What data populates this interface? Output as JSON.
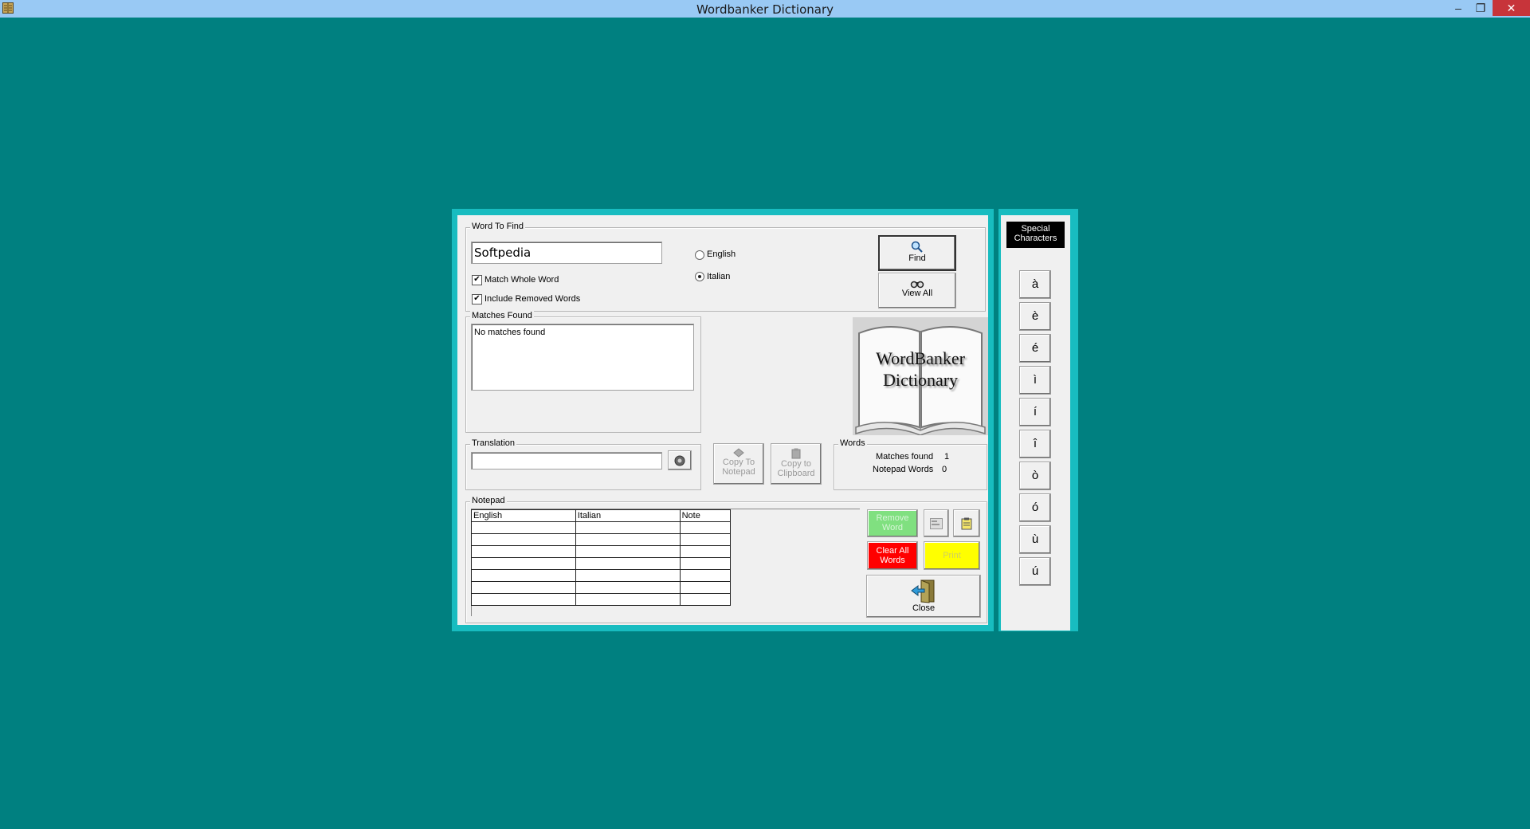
{
  "window": {
    "title": "Wordbanker Dictionary",
    "minimize": "–",
    "restore": "❐",
    "close": "✕"
  },
  "search": {
    "group_label": "Word To Find",
    "value": "Softpedia",
    "match_whole_word": "Match Whole Word",
    "include_removed": "Include Removed Words",
    "lang_english": "English",
    "lang_italian": "Italian",
    "selected_language": "Italian",
    "find_label": "Find",
    "view_all_label": "View All"
  },
  "matches": {
    "group_label": "Matches Found",
    "items": [
      "No matches found"
    ]
  },
  "logo": {
    "line1": "WordBanker",
    "line2": "Dictionary"
  },
  "translation": {
    "group_label": "Translation",
    "value": ""
  },
  "copy_actions": {
    "copy_notepad_line1": "Copy To",
    "copy_notepad_line2": "Notepad",
    "copy_clipboard_line1": "Copy to",
    "copy_clipboard_line2": "Clipboard"
  },
  "words": {
    "group_label": "Words",
    "matches_label": "Matches found",
    "matches_value": "1",
    "notepad_label": "Notepad Words",
    "notepad_value": "0"
  },
  "notepad": {
    "group_label": "Notepad",
    "columns": [
      "English",
      "Italian",
      "Note"
    ],
    "row_count": 7,
    "remove_line1": "Remove",
    "remove_line2": "Word",
    "clear_line1": "Clear All",
    "clear_line2": "Words",
    "print_label": "Print",
    "close_label": "Close"
  },
  "special": {
    "title_line1": "Special",
    "title_line2": "Characters",
    "chars": [
      "à",
      "è",
      "é",
      "ì",
      "í",
      "î",
      "ò",
      "ó",
      "ù",
      "ú"
    ]
  },
  "colors": {
    "desktop": "#008080",
    "frame": "#18bcc0",
    "remove_bg": "#80e080",
    "clear_bg": "#ff0000",
    "print_bg": "#ffff00"
  }
}
